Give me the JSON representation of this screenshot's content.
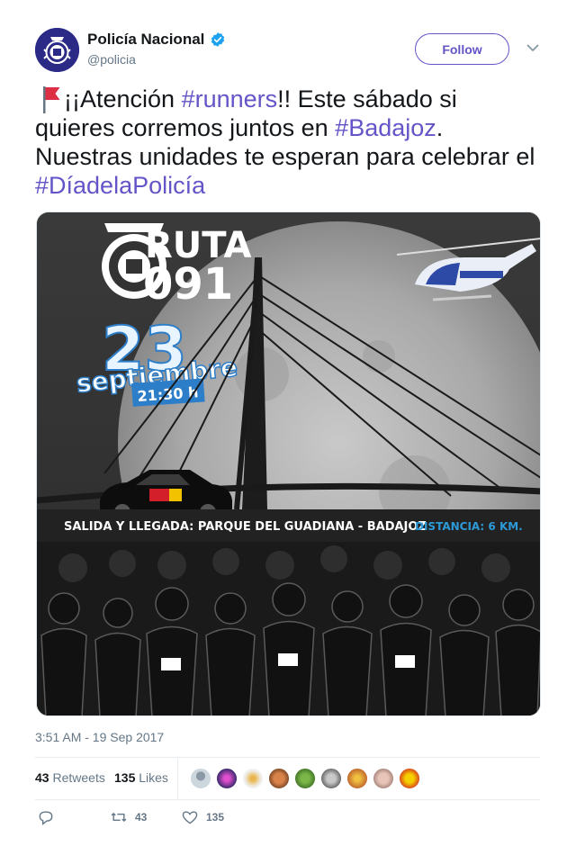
{
  "account": {
    "display_name": "Policía Nacional",
    "handle": "@policia",
    "verified": true,
    "avatar_icon": "police-badge-icon"
  },
  "follow_label": "Follow",
  "tweet": {
    "emoji": "red-flag-icon",
    "segments": [
      {
        "text": "¡¡Atención ",
        "type": "text"
      },
      {
        "text": "#runners",
        "type": "hashtag"
      },
      {
        "text": "!! Este sábado si quieres corremos juntos en ",
        "type": "text"
      },
      {
        "text": "#Badajoz",
        "type": "hashtag"
      },
      {
        "text": ". Nuestras unidades te esperan para celebrar el ",
        "type": "text"
      },
      {
        "text": "#DíadelaPolicía",
        "type": "hashtag"
      }
    ]
  },
  "media": {
    "title_line1": "RUTA",
    "title_line2": "091",
    "day": "23",
    "month": "septiembre",
    "time": "21:30 h",
    "banner_left": "SALIDA Y LLEGADA: PARQUE DEL GUADIANA - BADAJOZ",
    "banner_right": "DISTANCIA: 6 KM."
  },
  "timestamp": "3:51 AM - 19 Sep 2017",
  "stats": {
    "retweets_count": "43",
    "retweets_label": "Retweets",
    "likes_count": "135",
    "likes_label": "Likes"
  },
  "actions": {
    "retweet_count": "43",
    "like_count": "135"
  },
  "colors": {
    "accent": "#6355c7",
    "verified": "#1da1f2",
    "muted": "#657786"
  }
}
